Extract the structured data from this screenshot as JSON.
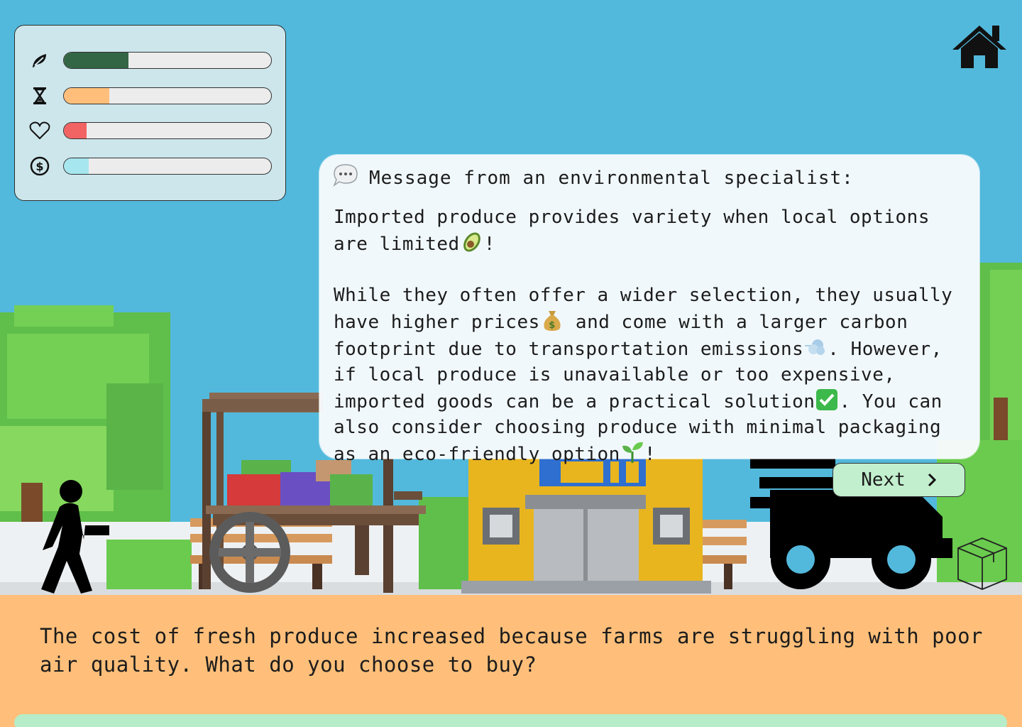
{
  "stats": [
    {
      "name": "environment",
      "icon": "leaf-icon",
      "value": 0.31,
      "color": "#336644"
    },
    {
      "name": "time",
      "icon": "hourglass-icon",
      "value": 0.22,
      "color": "#ffbf7a"
    },
    {
      "name": "health",
      "icon": "heart-icon",
      "value": 0.11,
      "color": "#f26363"
    },
    {
      "name": "money",
      "icon": "money-icon",
      "value": 0.12,
      "color": "#a6e6ef"
    }
  ],
  "message": {
    "title": "Message from an environmental specialist:",
    "p1_a": "Imported produce provides variety when local options are limited",
    "p1_b": "!",
    "p2_a": "While they often offer a wider selection, they usually have higher prices",
    "p2_b": " and come with a larger carbon footprint due to transportation emissions",
    "p2_c": ". However, if local produce is unavailable or too expensive, imported goods can be a practical solution",
    "p2_d": ". You can also consider choosing produce with minimal packaging as an eco-friendly option",
    "p2_e": "!"
  },
  "next_label": "Next",
  "prompt": "The cost of fresh produce increased because farms are struggling with poor air quality. What do you choose to buy?",
  "icons": [
    "home-icon",
    "speech-bubble-icon",
    "avocado-icon",
    "money-bag-icon",
    "dash-icon",
    "check-mark-icon",
    "seedling-icon",
    "walking-person-icon",
    "delivery-truck-icon",
    "package-icon",
    "chevron-right-icon"
  ]
}
